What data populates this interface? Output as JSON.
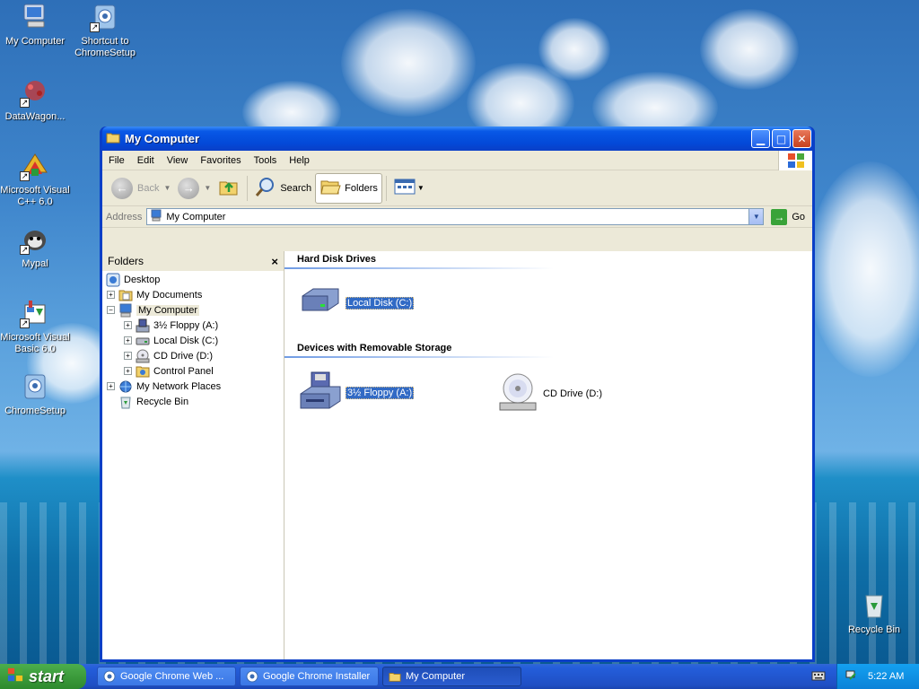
{
  "desktop": {
    "icons": [
      {
        "label": "My Computer",
        "icon": "my-computer-icon"
      },
      {
        "label": "Shortcut to ChromeSetup",
        "icon": "chrome-setup-shortcut-icon"
      },
      {
        "label": "DataWagon...",
        "icon": "datawagon-icon"
      },
      {
        "label": "Microsoft Visual C++ 6.0",
        "icon": "visual-cpp-icon"
      },
      {
        "label": "Mypal",
        "icon": "mypal-icon"
      },
      {
        "label": "Microsoft Visual Basic 6.0",
        "icon": "visual-basic-icon"
      },
      {
        "label": "ChromeSetup",
        "icon": "chrome-setup-icon"
      },
      {
        "label": "Recycle Bin",
        "icon": "recycle-bin-icon"
      }
    ]
  },
  "window": {
    "title": "My Computer",
    "menu": [
      "File",
      "Edit",
      "View",
      "Favorites",
      "Tools",
      "Help"
    ],
    "toolbar": {
      "back": "Back",
      "search": "Search",
      "folders": "Folders"
    },
    "address": {
      "label": "Address",
      "value": "My Computer",
      "go": "Go"
    },
    "folders_pane": {
      "title": "Folders",
      "tree": [
        {
          "label": "Desktop",
          "level": 0,
          "expander": ""
        },
        {
          "label": "My Documents",
          "level": 1,
          "expander": "+"
        },
        {
          "label": "My Computer",
          "level": 1,
          "expander": "−"
        },
        {
          "label": "3½ Floppy (A:)",
          "level": 2,
          "expander": "+"
        },
        {
          "label": "Local Disk (C:)",
          "level": 2,
          "expander": "+"
        },
        {
          "label": "CD Drive (D:)",
          "level": 2,
          "expander": "+"
        },
        {
          "label": "Control Panel",
          "level": 2,
          "expander": "+"
        },
        {
          "label": "My Network Places",
          "level": 1,
          "expander": "+"
        },
        {
          "label": "Recycle Bin",
          "level": 1,
          "expander": ""
        }
      ]
    },
    "content": {
      "hard_disk_heading": "Hard Disk Drives",
      "local_disk": "Local Disk (C:)",
      "removable_heading": "Devices with Removable Storage",
      "floppy": "3½ Floppy (A:)",
      "cd_drive": "CD Drive (D:)"
    }
  },
  "taskbar": {
    "start": "start",
    "tasks": [
      {
        "label": "Google Chrome Web ...",
        "active": false
      },
      {
        "label": "Google Chrome Installer",
        "active": false
      },
      {
        "label": "My Computer",
        "active": true
      }
    ],
    "clock": "5:22 AM"
  },
  "colors": {
    "titlebar": "#0349d8",
    "selection": "#316ac5",
    "taskbar": "#245edb",
    "start": "#3c9b3c"
  }
}
